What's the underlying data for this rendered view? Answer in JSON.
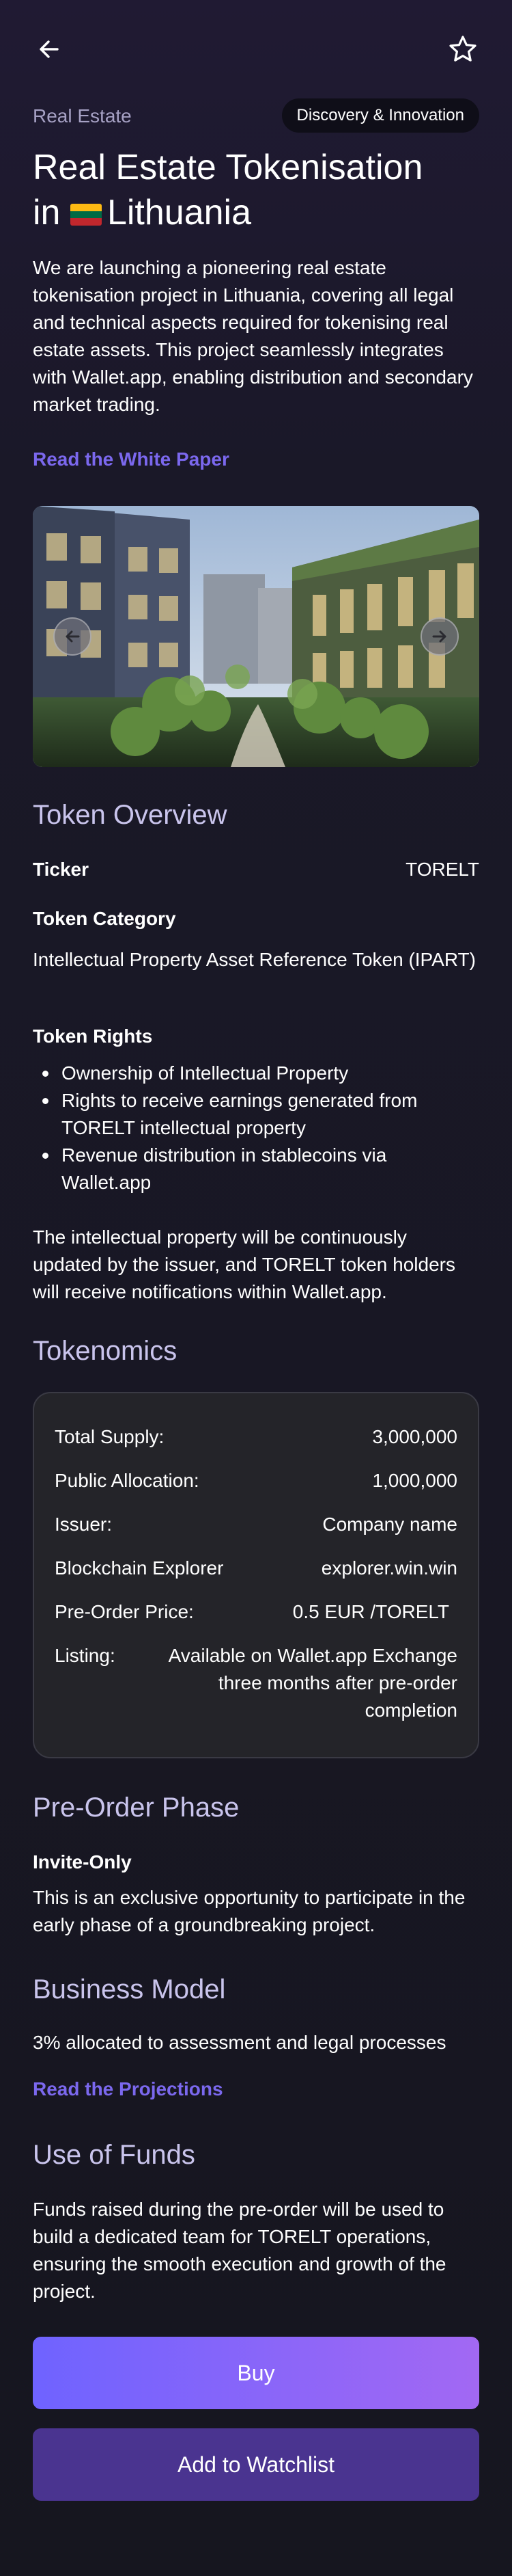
{
  "header": {
    "category": "Real Estate",
    "chip": "Discovery & Innovation",
    "title_line1": "Real Estate Tokenisation",
    "title_line2": "Lithuania",
    "title_prefix": "in",
    "icons": {
      "back": "arrow-left-icon",
      "favorite": "star-outline-icon",
      "flag": "lithuania-flag-icon"
    },
    "flag_colors": [
      "#fdb913",
      "#006a44",
      "#c1272d"
    ]
  },
  "intro": {
    "text": "We are launching a pioneering real estate tokenisation project in Lithuania, covering all legal and technical aspects required for tokenising real estate assets. This project seamlessly integrates with Wallet.app, enabling distribution and secondary market trading.",
    "link": "Read the White Paper"
  },
  "carousel": {
    "icons": {
      "prev": "arrow-left-circle-icon",
      "next": "arrow-right-circle-icon"
    }
  },
  "token_overview": {
    "title": "Token Overview",
    "ticker_label": "Ticker",
    "ticker_value": "TORELT",
    "category_label": "Token Category",
    "category_value": "Intellectual Property Asset Reference Token (IPART)",
    "rights_label": "Token Rights",
    "rights": [
      "Ownership of Intellectual Property",
      "Rights to receive earnings generated from TORELT intellectual property",
      "Revenue distribution in stablecoins via Wallet.app"
    ],
    "note": "The intellectual property will be continuously updated by the issuer, and TORELT token holders will receive notifications within Wallet.app."
  },
  "tokenomics": {
    "title": "Tokenomics",
    "rows": [
      {
        "key": "Total Supply:",
        "value": "3,000,000"
      },
      {
        "key": "Public Allocation:",
        "value": "1,000,000"
      },
      {
        "key": "Issuer:",
        "value": "Company name"
      },
      {
        "key": "Blockchain Explorer",
        "value": "explorer.win.win"
      },
      {
        "key": "Pre-Order Price:",
        "value": "0.5 EUR /TORELT"
      },
      {
        "key": "Listing:",
        "value": "Available on Wallet.app Exchange three months after pre-order completion"
      }
    ]
  },
  "preorder": {
    "title": "Pre-Order Phase",
    "subtitle": "Invite-Only",
    "text": "This is an exclusive opportunity to participate in the early phase of a groundbreaking project."
  },
  "business": {
    "title": "Business Model",
    "text": "3% allocated to assessment and legal processes",
    "link": "Read the Projections"
  },
  "funds": {
    "title": "Use of Funds",
    "text": "Funds raised during the pre-order will be used to build a dedicated team for TORELT operations, ensuring the smooth execution and growth of the project."
  },
  "actions": {
    "buy": "Buy",
    "watchlist": "Add to Watchlist"
  },
  "colors": {
    "accent": "#7b68ee",
    "section_title": "#c9c4ec",
    "buy_start": "#6f63ff",
    "buy_end": "#a268f3",
    "watchlist": "#4a3490"
  }
}
